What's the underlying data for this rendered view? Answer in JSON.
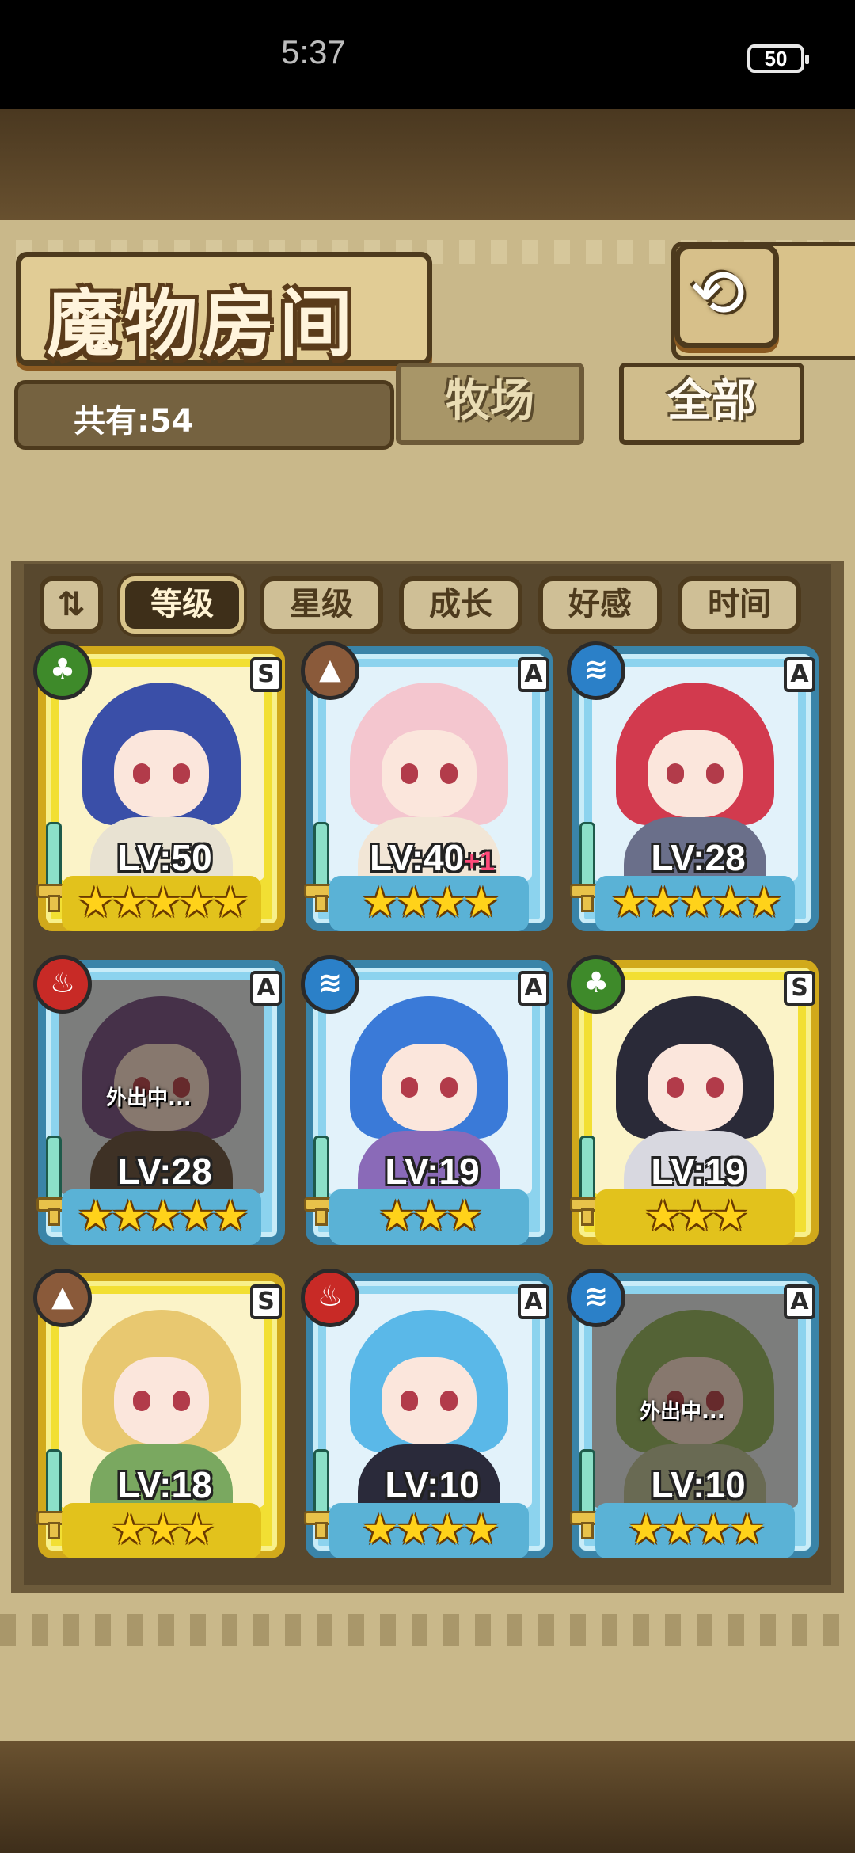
{
  "status": {
    "time": "5:37",
    "battery": "50"
  },
  "header": {
    "title": "魔物房间",
    "back_icon": "⟲"
  },
  "count_text": "共有:54",
  "tabs": [
    {
      "label": "牧场",
      "active": false
    },
    {
      "label": "全部",
      "active": true
    }
  ],
  "sort": {
    "toggle": "⇅",
    "buttons": [
      {
        "label": "等级",
        "active": true
      },
      {
        "label": "星级",
        "active": false
      },
      {
        "label": "成长",
        "active": false
      },
      {
        "label": "好感",
        "active": false
      },
      {
        "label": "时间",
        "active": false
      }
    ]
  },
  "away_label": "外出中...",
  "monsters": [
    {
      "rank": "S",
      "element": "grass",
      "level": "LV:50",
      "bonus": "",
      "stars": "★★★★★",
      "away": false,
      "hair": "#3a4fa8",
      "body": "#e8e2d2"
    },
    {
      "rank": "A",
      "element": "earth",
      "level": "LV:40",
      "bonus": "+1",
      "stars": "★★★★",
      "away": false,
      "hair": "#f4c6cf",
      "body": "#f2e6d6"
    },
    {
      "rank": "A",
      "element": "water",
      "level": "LV:28",
      "bonus": "",
      "stars": "★★★★★",
      "away": false,
      "hair": "#d23a4e",
      "body": "#6a6f8a"
    },
    {
      "rank": "A",
      "element": "fire",
      "level": "LV:28",
      "bonus": "",
      "stars": "★★★★★",
      "away": true,
      "hair": "#6a4a8a",
      "body": "#5a4a3a"
    },
    {
      "rank": "A",
      "element": "water",
      "level": "LV:19",
      "bonus": "",
      "stars": "★★★",
      "away": false,
      "hair": "#3a7ad8",
      "body": "#8a6ab8"
    },
    {
      "rank": "S",
      "element": "grass",
      "level": "LV:19",
      "bonus": "",
      "stars": "★★★",
      "away": false,
      "hair": "#2a2a38",
      "body": "#d8d8e0"
    },
    {
      "rank": "S",
      "element": "earth",
      "level": "LV:18",
      "bonus": "",
      "stars": "★★★",
      "away": false,
      "hair": "#e8c870",
      "body": "#7aa860"
    },
    {
      "rank": "A",
      "element": "fire",
      "level": "LV:10",
      "bonus": "",
      "stars": "★★★★",
      "away": false,
      "hair": "#5ab8e8",
      "body": "#2a2a3a"
    },
    {
      "rank": "A",
      "element": "water",
      "level": "LV:10",
      "bonus": "",
      "stars": "★★★★",
      "away": true,
      "hair": "#8ab860",
      "body": "#b8c8a0"
    }
  ]
}
